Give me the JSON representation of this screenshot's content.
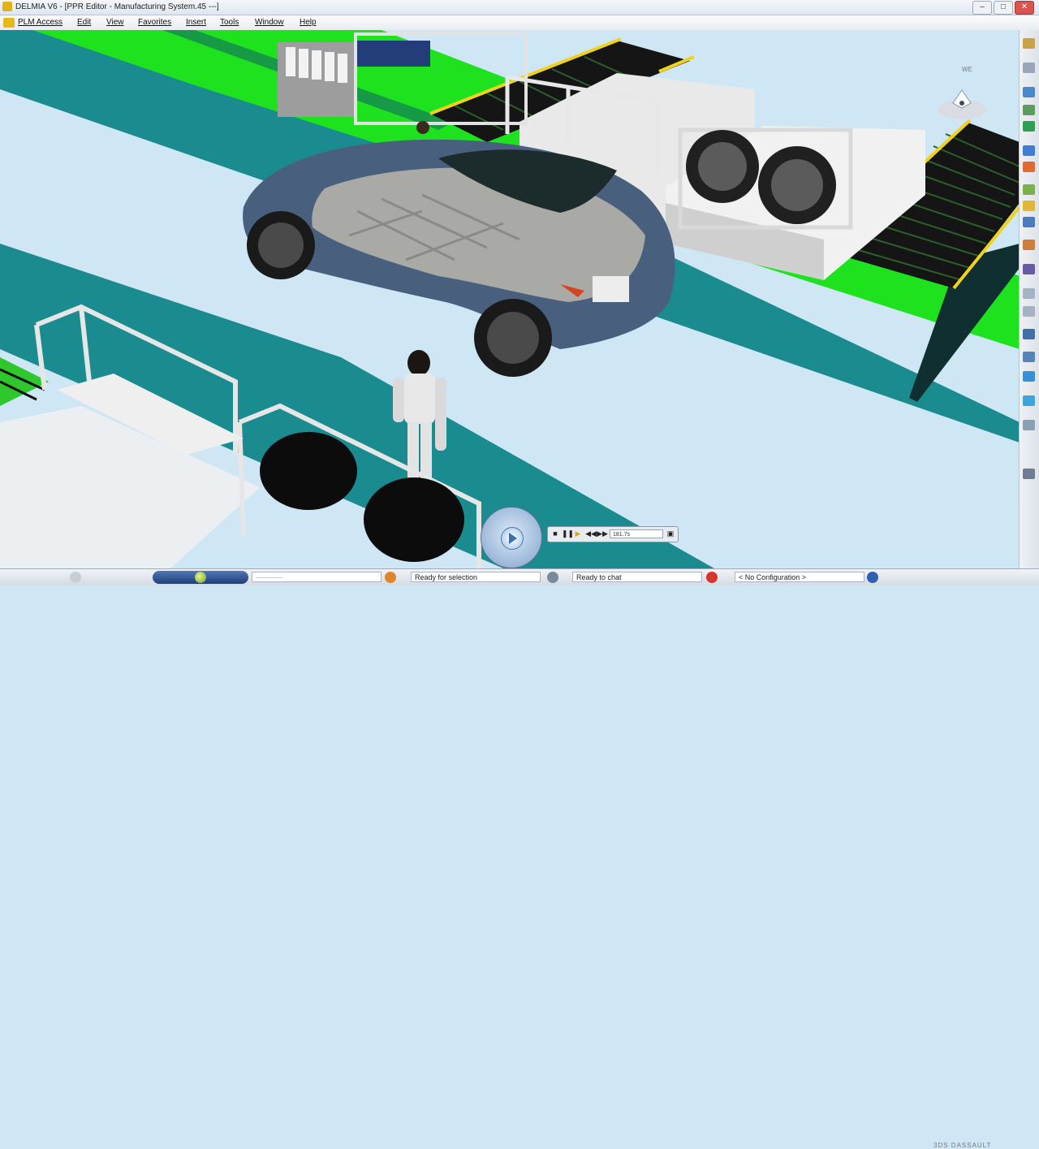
{
  "window": {
    "title": "DELMIA V6 - [PPR Editor - Manufacturing System.45 ---]",
    "minimize": "–",
    "maximize": "□",
    "close": "✕"
  },
  "menu": {
    "items": [
      "PLM Access",
      "Edit",
      "View",
      "Favorites",
      "Insert",
      "Tools",
      "Window",
      "Help"
    ]
  },
  "viewport": {
    "compass_label": "WE"
  },
  "toolbar_right": {
    "icons": [
      "save-icon",
      "sync-icon",
      "constraint-icon",
      "measure-icon",
      "layer-icon",
      "curve-icon",
      "color-icon",
      "fit-all-icon",
      "pan-icon",
      "rotate-icon",
      "zoom-in-icon",
      "zoom-out-icon",
      "normal-view-icon",
      "iso-view-icon",
      "shading-icon",
      "hide-show-icon",
      "swap-visible-icon",
      "properties-icon",
      "grid-icon",
      "render-icon"
    ]
  },
  "player": {
    "stop": "■",
    "pause": "❚❚",
    "play": "▶",
    "rewind": "◀◀",
    "forward": "▶▶",
    "time": "181.7s"
  },
  "statusbar": {
    "search_placeholder": "-----------",
    "selection_status": "Ready for selection",
    "chat_status": "Ready to chat",
    "configuration": "< No Configuration >",
    "brand": "3DS DASSAULT"
  },
  "colors": {
    "floor_light": "#cfe6f5",
    "floor_teal": "#1a8c8f",
    "floor_green": "#1fe21f",
    "car_body": "#48607e",
    "conveyor_rail": "#f0d21c"
  }
}
